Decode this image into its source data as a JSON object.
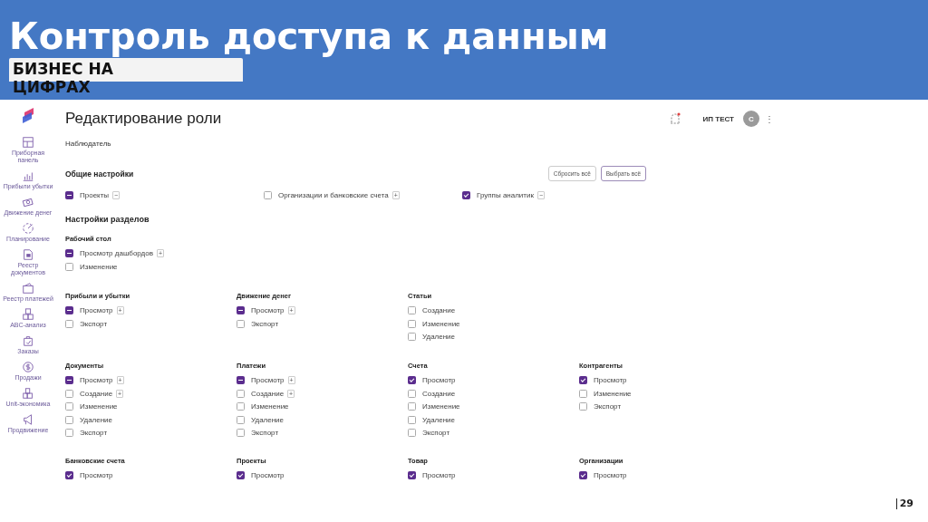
{
  "slide": {
    "title": "Контроль доступа к данным",
    "subtitle": "БИЗНЕС НА ЦИФРАХ",
    "page_number": "29"
  },
  "sidebar": {
    "items": [
      {
        "label": "Приборная панель"
      },
      {
        "label": "Прибыли убытки"
      },
      {
        "label": "Движение денег"
      },
      {
        "label": "Планирование"
      },
      {
        "label": "Реестр документов"
      },
      {
        "label": "Реестр платежей"
      },
      {
        "label": "ABC-анализ"
      },
      {
        "label": "Заказы"
      },
      {
        "label": "Продажи"
      },
      {
        "label": "Unit-экономика"
      },
      {
        "label": "Продвижение"
      }
    ]
  },
  "header": {
    "title": "Редактирование роли",
    "account": "ИП ТЕСТ",
    "avatar": "С",
    "menu": "⋮"
  },
  "role_name": "Наблюдатель",
  "general": {
    "title": "Общие настройки",
    "buttons": [
      {
        "label": "Сбросить всё",
        "kind": "secondary"
      },
      {
        "label": "Выбрать всё",
        "kind": "primary"
      }
    ],
    "options": [
      {
        "label": "Проекты",
        "checked": true,
        "indeterminate": true,
        "toggle": "−"
      },
      {
        "label": "Организации и банковские счета",
        "checked": false,
        "indeterminate": false,
        "toggle": "+"
      },
      {
        "label": "Группы аналитик",
        "checked": true,
        "indeterminate": false,
        "toggle": "−"
      }
    ]
  },
  "sections_title": "Настройки разделов",
  "desktop": {
    "title": "Рабочий стол",
    "options": [
      {
        "label": "Просмотр дашбордов",
        "checked": true,
        "indeterminate": true,
        "toggle": "+"
      },
      {
        "label": "Изменение",
        "checked": false,
        "indeterminate": false
      }
    ]
  },
  "section_rows": [
    [
      {
        "title": "Прибыли и убытки",
        "options": [
          {
            "label": "Просмотр",
            "checked": true,
            "indeterminate": true,
            "toggle": "+"
          },
          {
            "label": "Экспорт",
            "checked": false,
            "indeterminate": false
          }
        ]
      },
      {
        "title": "Движение денег",
        "options": [
          {
            "label": "Просмотр",
            "checked": true,
            "indeterminate": true,
            "toggle": "+"
          },
          {
            "label": "Экспорт",
            "checked": false,
            "indeterminate": false
          }
        ]
      },
      {
        "title": "Статьи",
        "options": [
          {
            "label": "Создание",
            "checked": false,
            "indeterminate": false
          },
          {
            "label": "Изменение",
            "checked": false,
            "indeterminate": false
          },
          {
            "label": "Удаление",
            "checked": false,
            "indeterminate": false
          }
        ]
      }
    ],
    [
      {
        "title": "Документы",
        "options": [
          {
            "label": "Просмотр",
            "checked": true,
            "indeterminate": true,
            "toggle": "+"
          },
          {
            "label": "Создание",
            "checked": false,
            "indeterminate": false,
            "toggle": "+"
          },
          {
            "label": "Изменение",
            "checked": false,
            "indeterminate": false
          },
          {
            "label": "Удаление",
            "checked": false,
            "indeterminate": false
          },
          {
            "label": "Экспорт",
            "checked": false,
            "indeterminate": false
          }
        ]
      },
      {
        "title": "Платежи",
        "options": [
          {
            "label": "Просмотр",
            "checked": true,
            "indeterminate": true,
            "toggle": "+"
          },
          {
            "label": "Создание",
            "checked": false,
            "indeterminate": false,
            "toggle": "+"
          },
          {
            "label": "Изменение",
            "checked": false,
            "indeterminate": false
          },
          {
            "label": "Удаление",
            "checked": false,
            "indeterminate": false
          },
          {
            "label": "Экспорт",
            "checked": false,
            "indeterminate": false
          }
        ]
      },
      {
        "title": "Счета",
        "options": [
          {
            "label": "Просмотр",
            "checked": true,
            "indeterminate": false
          },
          {
            "label": "Создание",
            "checked": false,
            "indeterminate": false
          },
          {
            "label": "Изменение",
            "checked": false,
            "indeterminate": false
          },
          {
            "label": "Удаление",
            "checked": false,
            "indeterminate": false
          },
          {
            "label": "Экспорт",
            "checked": false,
            "indeterminate": false
          }
        ]
      },
      {
        "title": "Контрагенты",
        "options": [
          {
            "label": "Просмотр",
            "checked": true,
            "indeterminate": false
          },
          {
            "label": "Изменение",
            "checked": false,
            "indeterminate": false
          },
          {
            "label": "Экспорт",
            "checked": false,
            "indeterminate": false
          }
        ]
      }
    ],
    [
      {
        "title": "Банковские счета",
        "options": [
          {
            "label": "Просмотр",
            "checked": true,
            "indeterminate": false
          }
        ]
      },
      {
        "title": "Проекты",
        "options": [
          {
            "label": "Просмотр",
            "checked": true,
            "indeterminate": false
          }
        ]
      },
      {
        "title": "Товар",
        "options": [
          {
            "label": "Просмотр",
            "checked": true,
            "indeterminate": false
          }
        ]
      },
      {
        "title": "Организации",
        "options": [
          {
            "label": "Просмотр",
            "checked": true,
            "indeterminate": false
          }
        ]
      }
    ]
  ]
}
